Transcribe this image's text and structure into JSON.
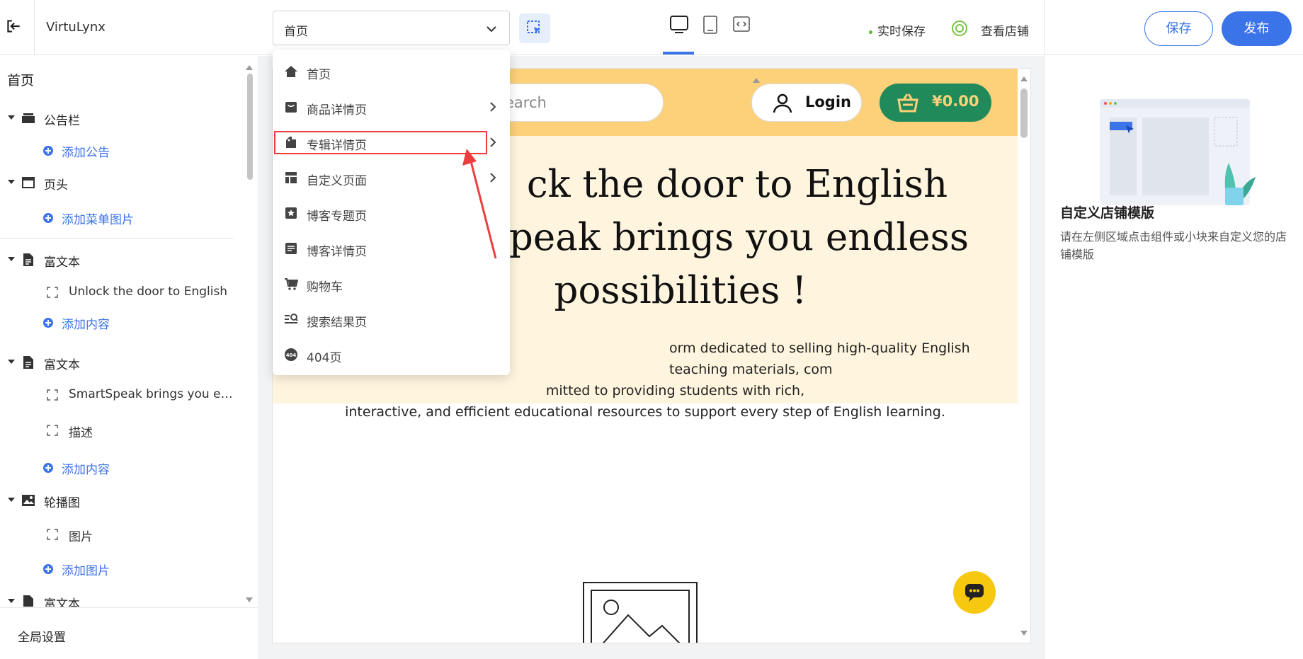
{
  "app": {
    "name": "VirtuLynx"
  },
  "toolbar": {
    "page_select_value": "首页",
    "autosave_label": "实时保存",
    "view_shop_label": "查看店铺",
    "save_label": "保存",
    "publish_label": "发布",
    "devices": [
      "desktop",
      "tablet",
      "fullscreen"
    ]
  },
  "page_menu": {
    "items": [
      {
        "label": "首页",
        "icon": "home-icon",
        "submenu": false
      },
      {
        "label": "商品详情页",
        "icon": "bag-icon",
        "submenu": true
      },
      {
        "label": "专辑详情页",
        "icon": "album-tag-icon",
        "submenu": true,
        "highlighted": true
      },
      {
        "label": "自定义页面",
        "icon": "layout-icon",
        "submenu": true
      },
      {
        "label": "博客专题页",
        "icon": "star-bookmark-icon",
        "submenu": false
      },
      {
        "label": "博客详情页",
        "icon": "document-icon",
        "submenu": false
      },
      {
        "label": "购物车",
        "icon": "cart-icon",
        "submenu": false
      },
      {
        "label": "搜索结果页",
        "icon": "search-list-icon",
        "submenu": false
      },
      {
        "label": "404页",
        "icon": "404-icon",
        "submenu": false
      }
    ]
  },
  "sidebar": {
    "title": "首页",
    "sections": [
      {
        "label": "公告栏",
        "icon": "announcement-icon",
        "children": [],
        "add_label": "添加公告"
      },
      {
        "label": "页头",
        "icon": "header-icon",
        "children": [],
        "add_label": "添加菜单图片"
      },
      {
        "label": "富文本",
        "icon": "richtext-icon",
        "children": [
          "Unlock the door to English"
        ],
        "add_label": "添加内容"
      },
      {
        "label": "富文本",
        "icon": "richtext-icon",
        "children": [
          "SmartSpeak brings you endl...",
          "描述"
        ],
        "add_label": "添加内容"
      },
      {
        "label": "轮播图",
        "icon": "carousel-icon",
        "children": [
          "图片"
        ],
        "add_label": "添加图片"
      },
      {
        "label": "富文本",
        "icon": "richtext-icon",
        "children": [],
        "add_label": ""
      }
    ],
    "footer_label": "全局设置"
  },
  "preview": {
    "search_placeholder": "earch",
    "login_label": "Login",
    "cart_amount": "¥0.00",
    "hero_lines": [
      "ck the door to English",
      "peak brings you endless",
      "possibilities !"
    ],
    "desc_lines": [
      "orm dedicated to selling high-quality English teaching materials, com",
      "mitted to providing students with rich,",
      "interactive, and efficient educational resources to support every step of English learning."
    ],
    "colors": {
      "header": "#fdd07a",
      "hero": "#fff5de",
      "cart": "#218a5a"
    }
  },
  "right_panel": {
    "title": "自定义店铺模版",
    "desc": "请在左侧区域点击组件或小块来自定义您的店铺模版"
  }
}
